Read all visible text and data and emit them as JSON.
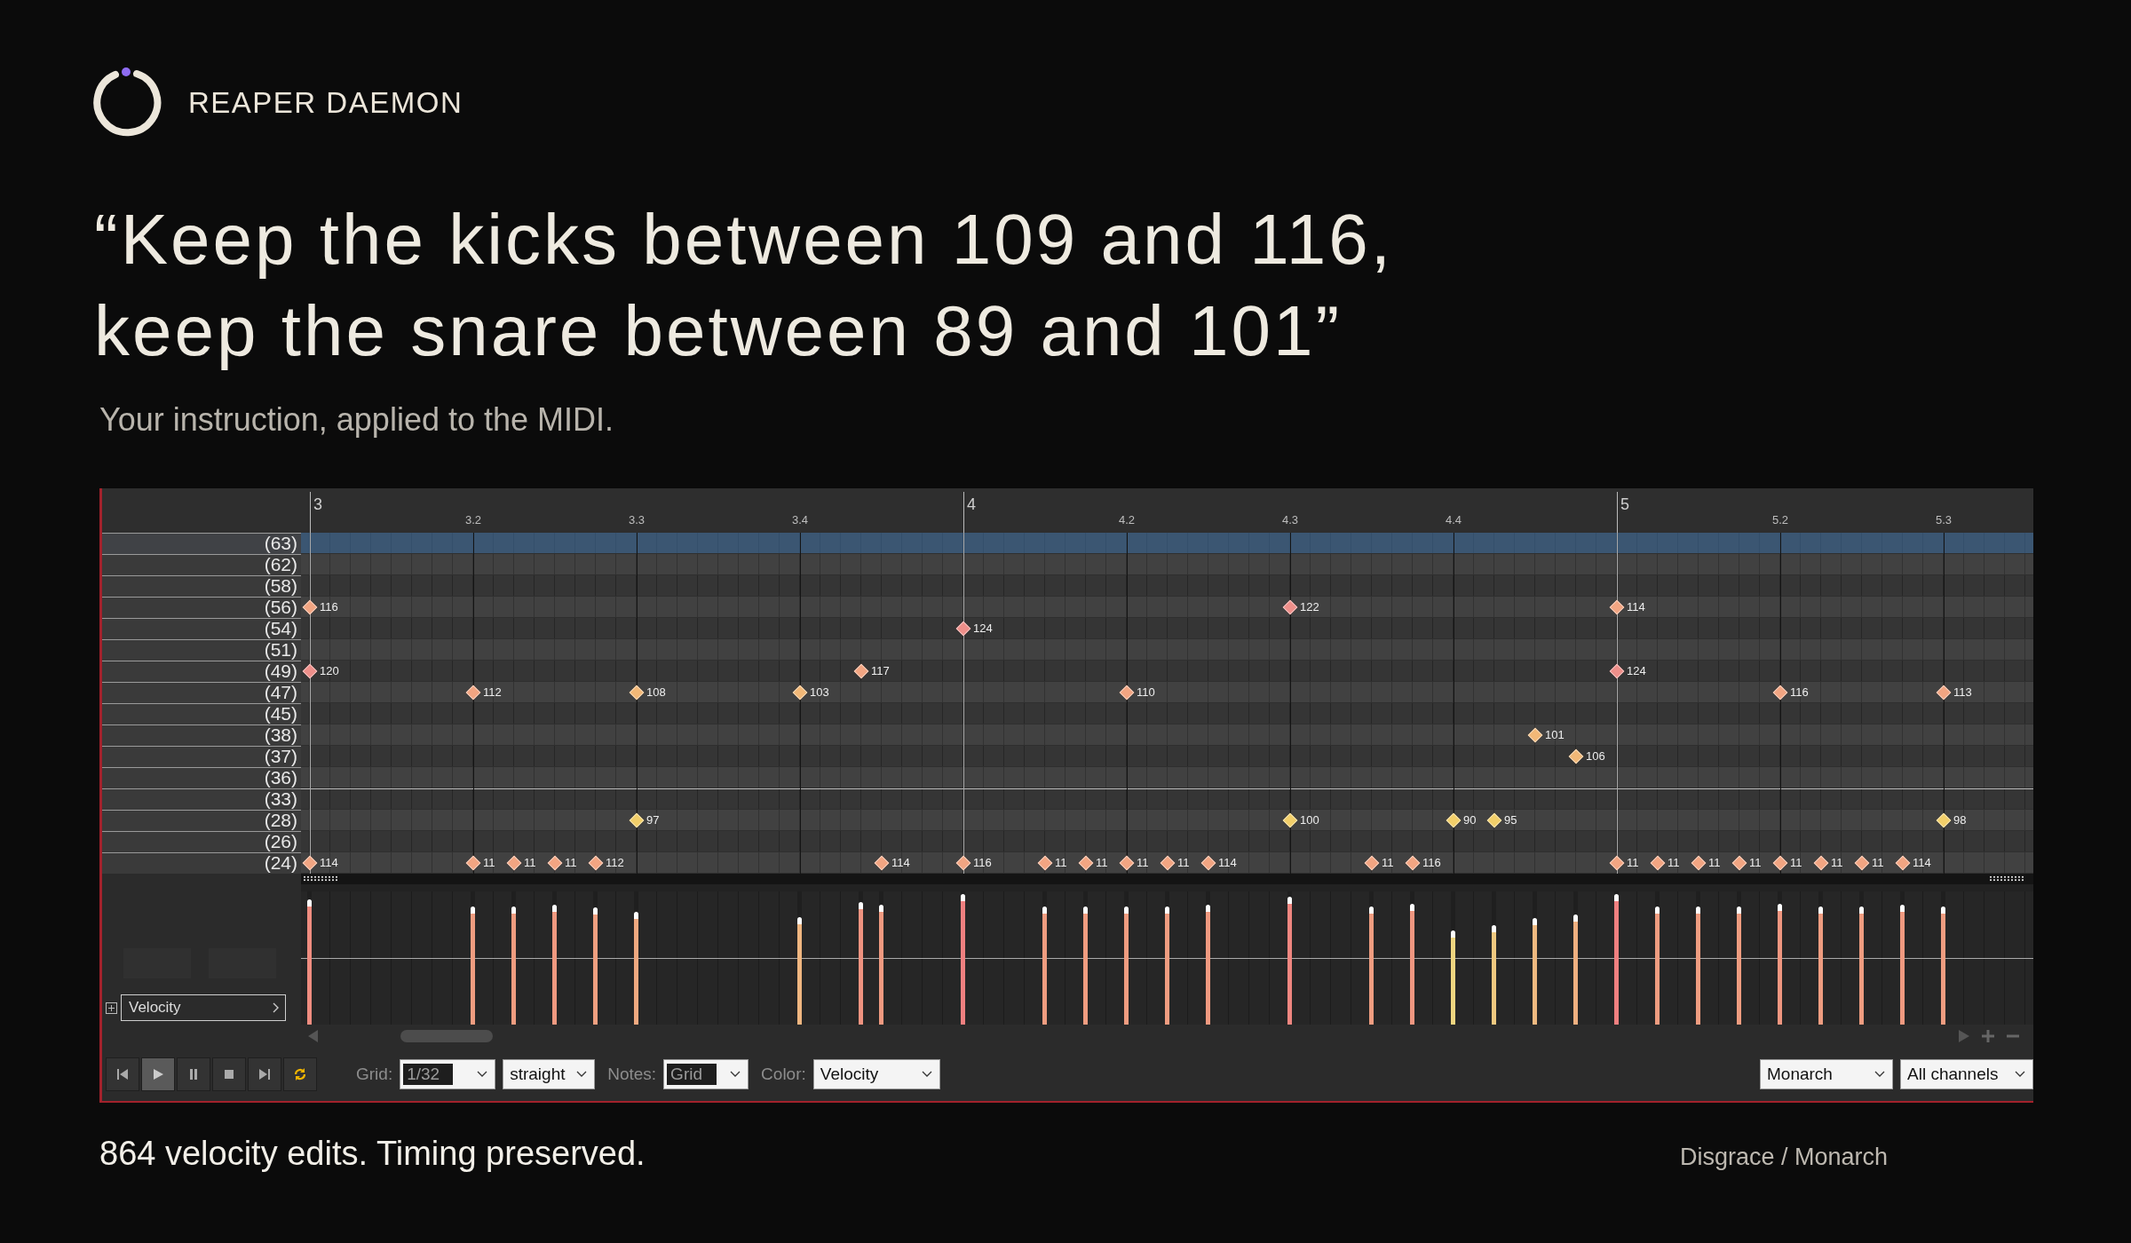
{
  "brand": {
    "name": "REAPER DAEMON"
  },
  "headline": [
    "“Keep the kicks between 109 and 116,",
    "keep the snare between 89 and 101”"
  ],
  "subtitle": "Your instruction, applied to the MIDI.",
  "editor": {
    "ruler": [
      {
        "label": "3",
        "kind": "measure"
      },
      {
        "label": "3.2",
        "kind": "beat"
      },
      {
        "label": "3.3",
        "kind": "beat"
      },
      {
        "label": "3.4",
        "kind": "beat"
      },
      {
        "label": "4",
        "kind": "measure"
      },
      {
        "label": "4.2",
        "kind": "beat"
      },
      {
        "label": "4.3",
        "kind": "beat"
      },
      {
        "label": "4.4",
        "kind": "beat"
      },
      {
        "label": "5",
        "kind": "measure"
      },
      {
        "label": "5.2",
        "kind": "beat"
      },
      {
        "label": "5.3",
        "kind": "beat"
      }
    ],
    "rows": [
      {
        "label": "(63)",
        "selected": true,
        "notes": []
      },
      {
        "label": "(62)",
        "selected": false,
        "notes": []
      },
      {
        "label": "(58)",
        "selected": false,
        "notes": []
      },
      {
        "label": "(56)",
        "selected": false,
        "notes": [
          {
            "velocity": "116",
            "color": "#f2a582"
          },
          {
            "velocity": "122",
            "color": "#ee8f8a"
          },
          {
            "velocity": "114",
            "color": "#f2a582"
          }
        ]
      },
      {
        "label": "(54)",
        "selected": false,
        "notes": [
          {
            "velocity": "124",
            "color": "#ee8f8a"
          }
        ]
      },
      {
        "label": "(51)",
        "selected": false,
        "notes": []
      },
      {
        "label": "(49)",
        "selected": false,
        "notes": [
          {
            "velocity": "120",
            "color": "#ee8f8a"
          },
          {
            "velocity": "117",
            "color": "#f2a582"
          },
          {
            "velocity": "124",
            "color": "#ee8f8a"
          }
        ]
      },
      {
        "label": "(47)",
        "selected": false,
        "notes": [
          {
            "velocity": "112",
            "color": "#f2a582"
          },
          {
            "velocity": "108",
            "color": "#f2b877"
          },
          {
            "velocity": "103",
            "color": "#f2b877"
          },
          {
            "velocity": "110",
            "color": "#f2a582"
          },
          {
            "velocity": "116",
            "color": "#f2a582"
          },
          {
            "velocity": "113",
            "color": "#f2a582"
          }
        ]
      },
      {
        "label": "(45)",
        "selected": false,
        "notes": []
      },
      {
        "label": "(38)",
        "selected": false,
        "notes": [
          {
            "velocity": "101",
            "color": "#f2b877"
          }
        ]
      },
      {
        "label": "(37)",
        "selected": false,
        "notes": [
          {
            "velocity": "106",
            "color": "#f2b877"
          }
        ]
      },
      {
        "label": "(36)",
        "selected": false,
        "notes": []
      },
      {
        "label": "(33)",
        "selected": false,
        "notes": []
      },
      {
        "label": "(28)",
        "selected": false,
        "notes": [
          {
            "velocity": "97",
            "color": "#f2cf6a"
          },
          {
            "velocity": "100",
            "color": "#f2cf6a"
          },
          {
            "velocity": "90",
            "color": "#f2cf6a"
          },
          {
            "velocity": "95",
            "color": "#f2cf6a"
          },
          {
            "velocity": "98",
            "color": "#f2cf6a"
          }
        ]
      },
      {
        "label": "(26)",
        "selected": false,
        "notes": []
      },
      {
        "label": "(24)",
        "selected": false,
        "notes": [
          {
            "velocity": "114",
            "color": "#f2a582"
          },
          {
            "velocity": "11",
            "color": "#f2a582"
          },
          {
            "velocity": "11",
            "color": "#f2a582"
          },
          {
            "velocity": "11",
            "color": "#f2a582"
          },
          {
            "velocity": "112",
            "color": "#f2a582"
          },
          {
            "velocity": "114",
            "color": "#f2a582"
          },
          {
            "velocity": "116",
            "color": "#f2a582"
          },
          {
            "velocity": "11",
            "color": "#f2a582"
          },
          {
            "velocity": "11",
            "color": "#f2a582"
          },
          {
            "velocity": "11",
            "color": "#f2a582"
          },
          {
            "velocity": "11",
            "color": "#f2a582"
          },
          {
            "velocity": "114",
            "color": "#f2a582"
          },
          {
            "velocity": "11",
            "color": "#f2a582"
          },
          {
            "velocity": "116",
            "color": "#f2a582"
          },
          {
            "velocity": "11",
            "color": "#f2a582"
          },
          {
            "velocity": "11",
            "color": "#f2a582"
          },
          {
            "velocity": "11",
            "color": "#f2a582"
          },
          {
            "velocity": "11",
            "color": "#f2a582"
          },
          {
            "velocity": "11",
            "color": "#f2a582"
          },
          {
            "velocity": "11",
            "color": "#f2a582"
          },
          {
            "velocity": "11",
            "color": "#f2a582"
          },
          {
            "velocity": "114",
            "color": "#f2a582"
          }
        ]
      }
    ],
    "lane": {
      "name": "Velocity",
      "stems": [
        {
          "level": 0.94
        },
        {
          "level": 0.89
        },
        {
          "level": 0.89
        },
        {
          "level": 0.9
        },
        {
          "level": 0.88
        },
        {
          "level": 0.85
        },
        {
          "level": 0.81
        },
        {
          "level": 0.92
        },
        {
          "level": 0.9
        },
        {
          "level": 0.98
        },
        {
          "level": 0.89
        },
        {
          "level": 0.89
        },
        {
          "level": 0.89
        },
        {
          "level": 0.89
        },
        {
          "level": 0.9
        },
        {
          "level": 0.96
        },
        {
          "level": 0.89
        },
        {
          "level": 0.91
        },
        {
          "level": 0.71
        },
        {
          "level": 0.75
        },
        {
          "level": 0.8
        },
        {
          "level": 0.83
        },
        {
          "level": 0.98
        },
        {
          "level": 0.89
        },
        {
          "level": 0.89
        },
        {
          "level": 0.89
        },
        {
          "level": 0.91
        },
        {
          "level": 0.89
        },
        {
          "level": 0.89
        },
        {
          "level": 0.9
        },
        {
          "level": 0.89
        }
      ]
    },
    "transport": [
      {
        "kind": "start",
        "on": false
      },
      {
        "kind": "play",
        "on": true
      },
      {
        "kind": "pause",
        "on": false
      },
      {
        "kind": "stop",
        "on": false
      },
      {
        "kind": "end",
        "on": false
      },
      {
        "kind": "loop",
        "on": false
      }
    ],
    "toolbar_left": [
      {
        "label": "Grid:",
        "value": "1/32",
        "inset": true
      },
      {
        "value": "straight",
        "inset": false
      },
      {
        "label": "Notes:",
        "value": "Grid",
        "inset": true
      },
      {
        "label": "Color:",
        "value": "Velocity",
        "inset": false
      }
    ],
    "toolbar_right": [
      {
        "value": "Monarch",
        "inset": false
      },
      {
        "value": "All channels",
        "inset": false
      }
    ]
  },
  "caption": "864 velocity edits. Timing preserved.",
  "credit": "Disgrace / Monarch"
}
